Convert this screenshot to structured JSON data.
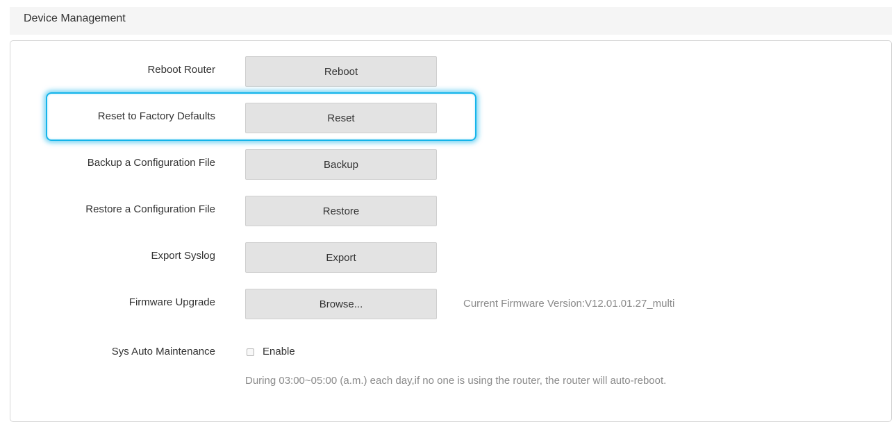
{
  "section": {
    "title": "Device Management"
  },
  "rows": {
    "reboot": {
      "label": "Reboot Router",
      "button": "Reboot"
    },
    "reset": {
      "label": "Reset to Factory Defaults",
      "button": "Reset"
    },
    "backup": {
      "label": "Backup a Configuration File",
      "button": "Backup"
    },
    "restore": {
      "label": "Restore a Configuration File",
      "button": "Restore"
    },
    "syslog": {
      "label": "Export Syslog",
      "button": "Export"
    },
    "firmware": {
      "label": "Firmware Upgrade",
      "button": "Browse...",
      "version_text": "Current Firmware Version:V12.01.01.27_multi"
    },
    "maintenance": {
      "label": "Sys Auto Maintenance",
      "checkbox_label": "Enable",
      "checked": false,
      "note": "During 03:00~05:00 (a.m.) each day,if no one is using the router, the router will auto-reboot."
    }
  },
  "colors": {
    "highlight": "#14b4ea",
    "button_bg": "#e3e3e3",
    "muted_text": "#8a8a8a"
  }
}
